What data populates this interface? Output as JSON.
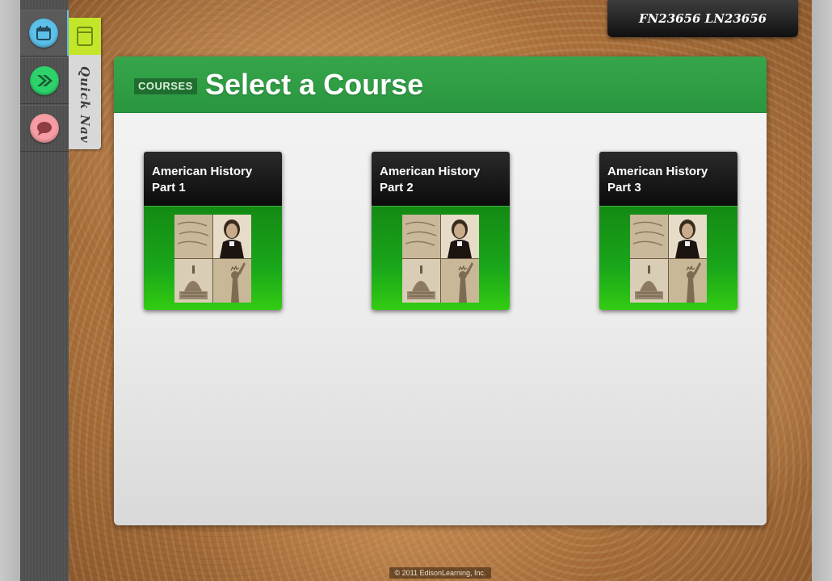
{
  "user": {
    "name": "FN23656 LN23656"
  },
  "sidebar": {
    "items": [
      {
        "icon": "calendar-icon",
        "color": "#5bc0ea",
        "active": true
      },
      {
        "icon": "double-chevron-right-icon",
        "color": "#2dd36a",
        "active": false
      },
      {
        "icon": "chat-bubble-icon",
        "color": "#f59ca4",
        "active": false
      }
    ]
  },
  "quick_nav": {
    "label": "Quick Nav",
    "icon": "book-icon",
    "accent": "#c3e62b"
  },
  "panel": {
    "badge": "COURSES",
    "title": "Select a Course",
    "header_color": "#2e9e45"
  },
  "courses": [
    {
      "title": "American History Part 1",
      "image": "american-history-collage"
    },
    {
      "title": "American History Part 2",
      "image": "american-history-collage"
    },
    {
      "title": "American History Part 3",
      "image": "american-history-collage"
    }
  ],
  "footer": {
    "copyright": "© 2011 EdisonLearning, Inc."
  }
}
